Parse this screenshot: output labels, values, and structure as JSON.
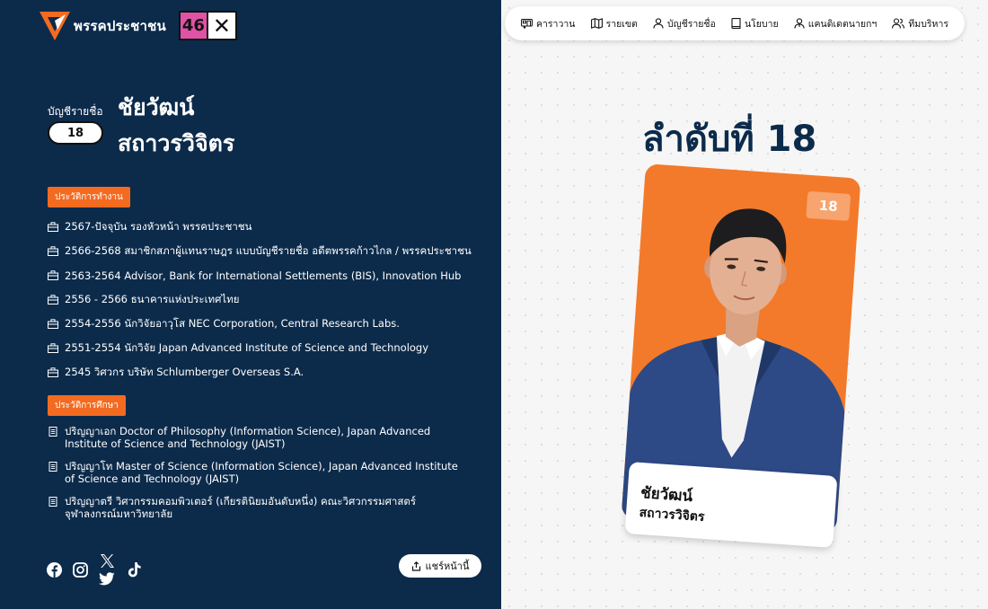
{
  "header": {
    "party_name": "พรรคประชาชน",
    "ballot_number": "46",
    "ballot_mark": "✕"
  },
  "nav": {
    "items": [
      {
        "label": "คาราวาน",
        "icon": "caravan-icon"
      },
      {
        "label": "รายเขต",
        "icon": "map-icon"
      },
      {
        "label": "บัญชีรายชื่อ",
        "icon": "person-icon"
      },
      {
        "label": "นโยบาย",
        "icon": "book-icon"
      },
      {
        "label": "แคนดิเดตนายกฯ",
        "icon": "candidate-icon"
      },
      {
        "label": "ทีมบริหาร",
        "icon": "team-icon"
      }
    ]
  },
  "profile": {
    "list_label": "บัญชีรายชื่อ",
    "list_number": "18",
    "first_name": "ชัยวัฒน์",
    "last_name": "สถาวรวิจิตร"
  },
  "work": {
    "tag": "ประวัติการทำงาน",
    "items": [
      "2567-ปัจจุบัน รองหัวหน้า พรรคประชาชน",
      "2566-2568 สมาชิกสภาผู้แทนราษฎร แบบบัญชีรายชื่อ อดีตพรรคก้าวไกล / พรรคประชาชน",
      "2563-2564 Advisor, Bank for International Settlements (BIS), Innovation Hub",
      "2556 - 2566 ธนาคารแห่งประเทศไทย",
      "2554-2556 นักวิจัยอาวุโส NEC Corporation, Central Research Labs.",
      "2551-2554 นักวิจัย Japan Advanced Institute of Science and Technology",
      "2545 วิศวกร บริษัท Schlumberger Overseas S.A."
    ]
  },
  "education": {
    "tag": "ประวัติการศึกษา",
    "items": [
      [
        "ปริญญาเอก Doctor of Philosophy (Information Science), Japan Advanced",
        "Institute of Science and Technology (JAIST)"
      ],
      [
        "ปริญญาโท Master of Science (Information Science), Japan Advanced Institute",
        "of Science and Technology (JAIST)"
      ],
      [
        "ปริญญาตรี วิศวกรรมคอมพิวเตอร์ (เกียรตินิยมอันดับหนึ่ง) คณะวิศวกรรมศาสตร์",
        "จุฬาลงกรณ์มหาวิทยาลัย"
      ]
    ]
  },
  "social": [
    "facebook-icon",
    "instagram-icon",
    "x-icon",
    "twitter-icon",
    "tiktok-icon"
  ],
  "share": {
    "label": "แชร์หน้านี้"
  },
  "rank": {
    "label": "ลำดับที่ 18"
  },
  "card": {
    "number": "18",
    "first_name": "ชัยวัฒน์",
    "last_name": "สถาวรวิจิตร"
  },
  "colors": {
    "navy": "#0c2b4b",
    "orange": "#f36b21",
    "pink": "#e052a6"
  }
}
